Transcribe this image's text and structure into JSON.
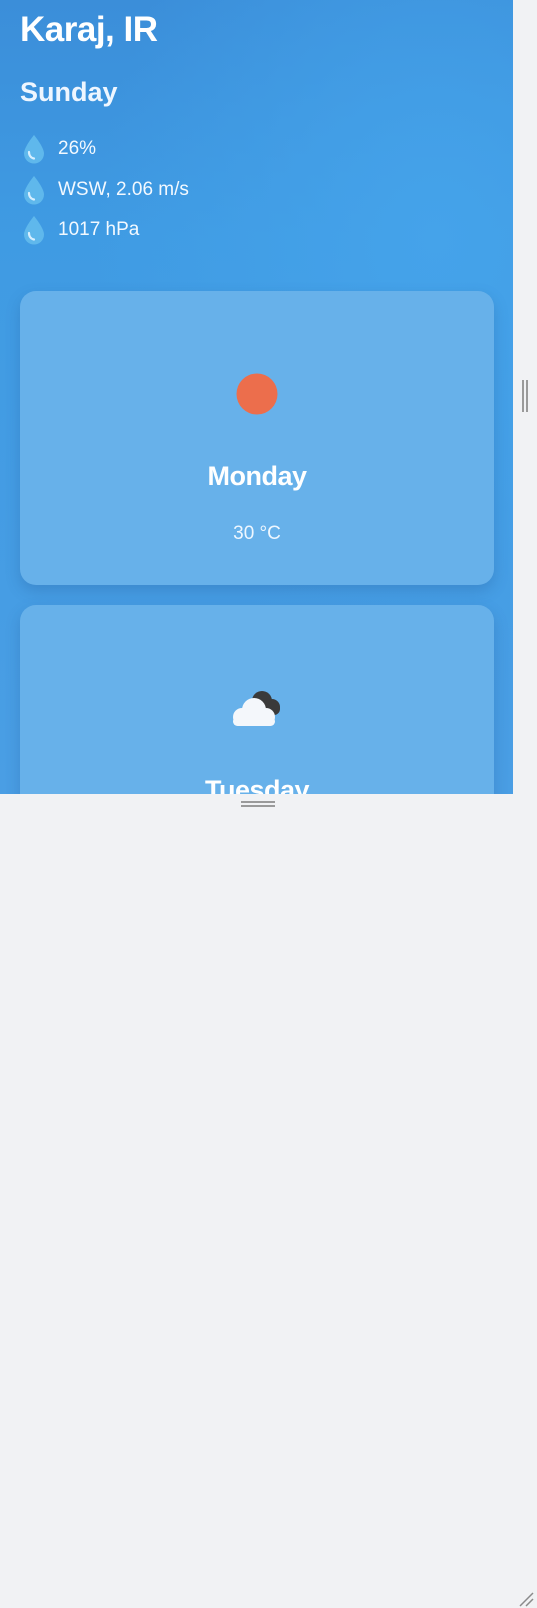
{
  "location": {
    "city": "Karaj, IR",
    "day": "Sunday"
  },
  "stats": {
    "humidity": "26%",
    "wind": "WSW, 2.06 m/s",
    "pressure": "1017 hPa"
  },
  "forecast": [
    {
      "day": "Monday",
      "temp": "30 °C",
      "icon": "sun-icon"
    },
    {
      "day": "Tuesday",
      "temp": "",
      "icon": "cloud-icon"
    }
  ],
  "colors": {
    "background": "#3f9be3",
    "card": "#67b1ea",
    "sun": "#ec6e4c",
    "drop": "#5fb8ec"
  }
}
